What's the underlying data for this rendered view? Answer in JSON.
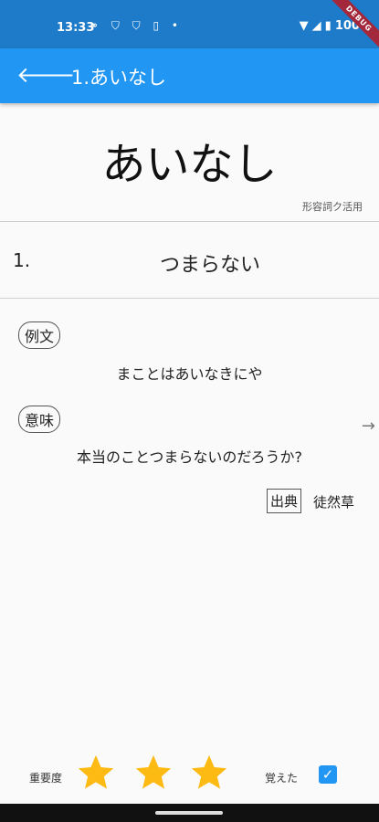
{
  "status_bar": {
    "time": "13:33",
    "icons_left": [
      "network-icon",
      "shield-icon",
      "shield-icon",
      "sim-icon",
      "dot-icon"
    ],
    "battery": "100%",
    "debug_banner": "DEBUG"
  },
  "app_bar": {
    "title": "1.あいなし"
  },
  "entry": {
    "headword": "あいなし",
    "part_of_speech": "形容詞ク活用",
    "meaning_number": "1.",
    "meaning": "つまらない",
    "example_tag": "例文",
    "example": "まことはあいなきにや",
    "translation_tag": "意味",
    "translation": "本当のことつまらないのだろうか?",
    "source_tag": "出典",
    "source": "徒然草"
  },
  "footer": {
    "importance_label": "重要度",
    "importance_stars": 3,
    "importance_max": 3,
    "memorized_label": "覚えた",
    "memorized": true,
    "star_color": "#fdba12",
    "checkbox_color": "#2196f3"
  },
  "colors": {
    "status_bar": "#1e7bc9",
    "app_bar": "#2196f3"
  }
}
